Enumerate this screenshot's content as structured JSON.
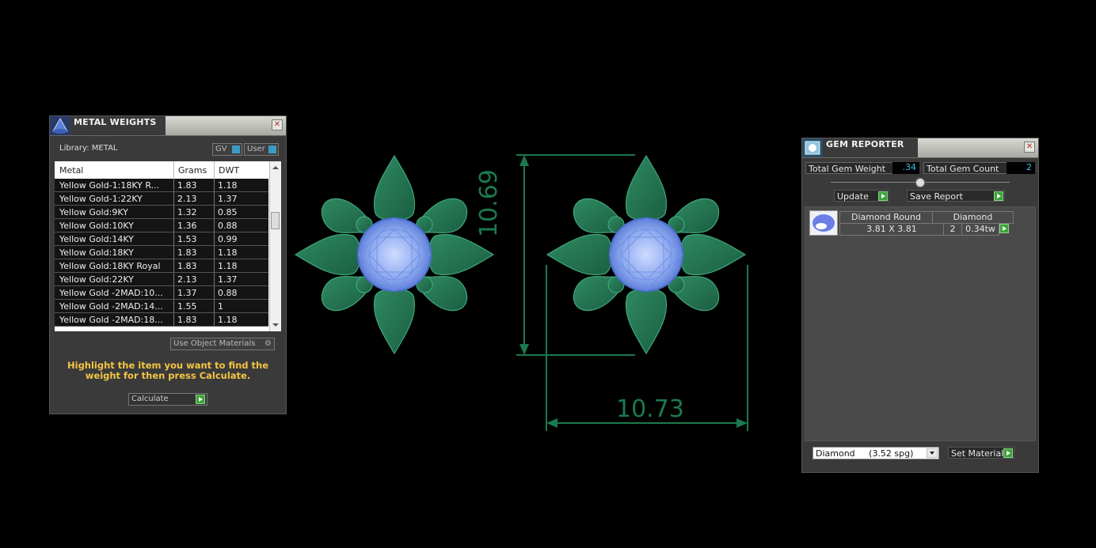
{
  "metal_weights": {
    "title": "METAL WEIGHTS",
    "library_label": "Library: METAL",
    "gv_label": "GV",
    "user_label": "User",
    "columns": [
      "Metal",
      "Grams",
      "DWT"
    ],
    "rows": [
      {
        "metal": "Yellow Gold-1:18KY R...",
        "grams": "1.83",
        "dwt": "1.18"
      },
      {
        "metal": "Yellow Gold-1:22KY",
        "grams": "2.13",
        "dwt": "1.37"
      },
      {
        "metal": "Yellow Gold:9KY",
        "grams": "1.32",
        "dwt": "0.85"
      },
      {
        "metal": "Yellow Gold:10KY",
        "grams": "1.36",
        "dwt": "0.88"
      },
      {
        "metal": "Yellow Gold:14KY",
        "grams": "1.53",
        "dwt": "0.99"
      },
      {
        "metal": "Yellow Gold:18KY",
        "grams": "1.83",
        "dwt": "1.18"
      },
      {
        "metal": "Yellow Gold:18KY Royal",
        "grams": "1.83",
        "dwt": "1.18"
      },
      {
        "metal": "Yellow Gold:22KY",
        "grams": "2.13",
        "dwt": "1.37"
      },
      {
        "metal": "Yellow Gold -2MAD:10...",
        "grams": "1.37",
        "dwt": "0.88"
      },
      {
        "metal": "Yellow Gold -2MAD:14...",
        "grams": "1.55",
        "dwt": "1"
      },
      {
        "metal": "Yellow Gold -2MAD:18...",
        "grams": "1.83",
        "dwt": "1.18"
      }
    ],
    "use_object_materials": "Use Object Materials",
    "instruction": "Highlight the item you want to find the weight for then press Calculate.",
    "calculate_label": "Calculate"
  },
  "dimensions": {
    "height": "10.69",
    "width": "10.73"
  },
  "gem_reporter": {
    "title": "GEM REPORTER",
    "total_weight_label": "Total Gem Weight",
    "total_weight_value": ".34",
    "total_count_label": "Total Gem Count",
    "total_count_value": "2",
    "update_label": "Update",
    "save_report_label": "Save Report",
    "gem": {
      "name": "Diamond Round",
      "material": "Diamond",
      "size": "3.81 X 3.81",
      "count": "2",
      "weight": "0.34tw"
    },
    "material_select": "Diamond     (3.52 spg)",
    "set_material_label": "Set Material"
  },
  "colors": {
    "metal_green": "#1f7a55",
    "gem_blue": "#8aa6ee",
    "accent_yellow": "#f5c542",
    "panel_bg": "#3a3a3a"
  }
}
